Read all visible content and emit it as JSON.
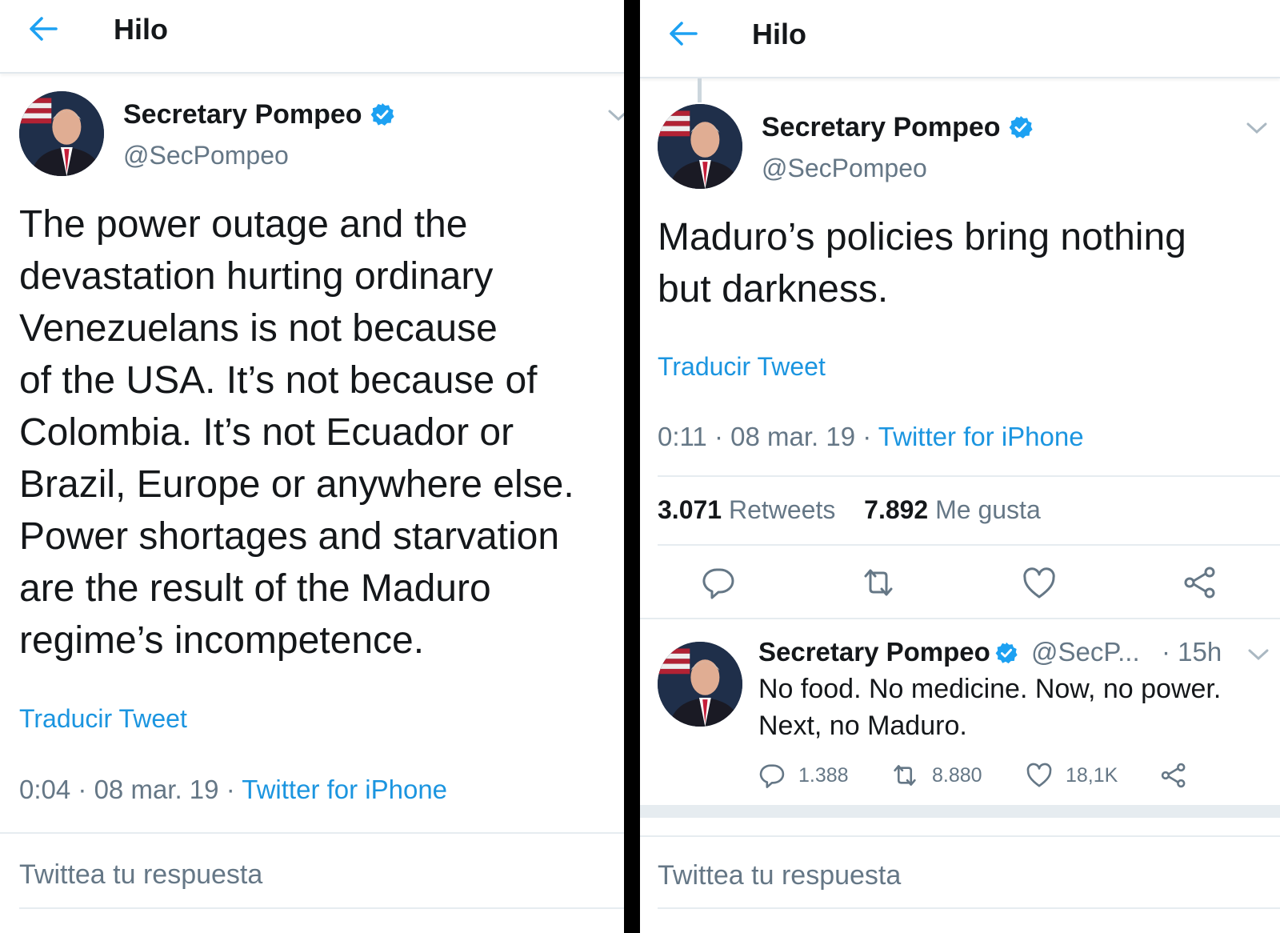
{
  "left": {
    "header": {
      "title": "Hilo"
    },
    "tweet": {
      "name": "Secretary Pompeo",
      "handle": "@SecPompeo",
      "lines": [
        "The power outage and the",
        "devastation hurting ordinary",
        "Venezuelans is not because",
        "of the USA. It’s not because of",
        "Colombia.  It’s not Ecuador or",
        "Brazil, Europe or anywhere else.",
        "Power shortages and starvation",
        "are the result of the Maduro",
        "regime’s incompetence."
      ],
      "translate": "Traducir Tweet",
      "time": "0:04",
      "date": "08 mar. 19",
      "source": "Twitter for iPhone"
    },
    "reply_placeholder": "Twittea tu respuesta"
  },
  "right": {
    "header": {
      "title": "Hilo"
    },
    "tweet": {
      "name": "Secretary Pompeo",
      "handle": "@SecPompeo",
      "lines": [
        "Maduro’s policies bring nothing",
        "but darkness."
      ],
      "translate": "Traducir Tweet",
      "time": "0:11",
      "date": "08 mar. 19",
      "source": "Twitter for iPhone",
      "retweets": "3.071",
      "retweets_label": "Retweets",
      "likes": "7.892",
      "likes_label": "Me gusta"
    },
    "reply_tweet": {
      "name": "Secretary Pompeo",
      "handle": "@SecP...",
      "time": "· 15h",
      "lines": [
        "No food. No medicine. Now, no power.",
        "Next, no Maduro."
      ],
      "replies": "1.388",
      "retweets": "8.880",
      "likes": "18,1K"
    },
    "reply_placeholder": "Twittea tu respuesta"
  },
  "colors": {
    "link": "#1b95e0",
    "muted": "#657786",
    "text": "#14171a",
    "verified": "#1da1f2"
  }
}
